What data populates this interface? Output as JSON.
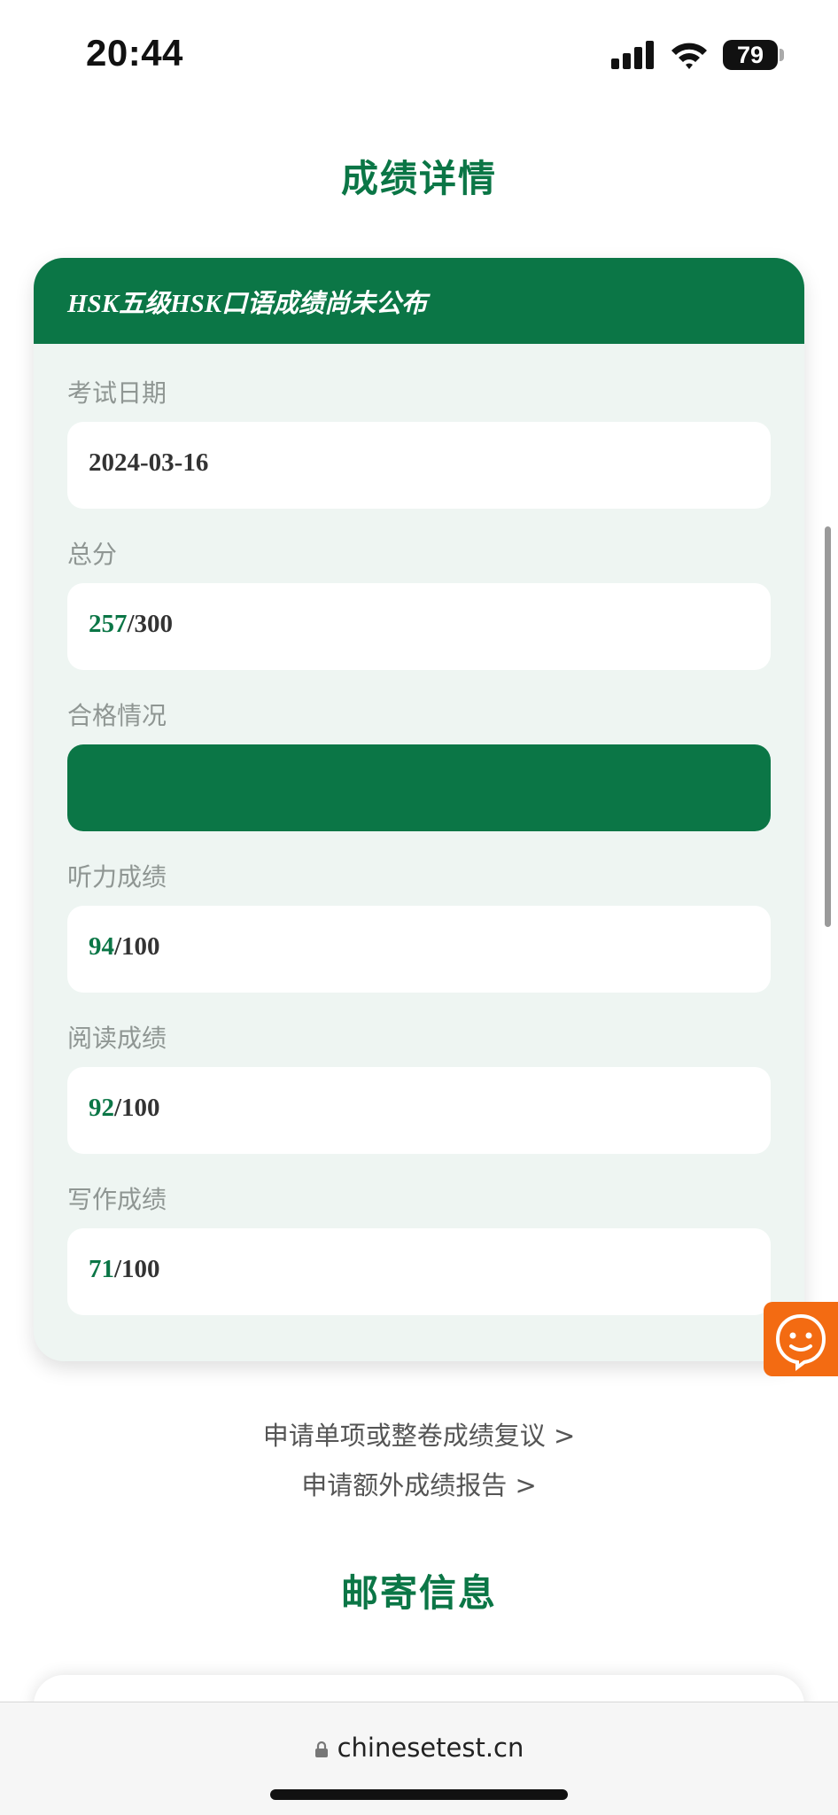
{
  "status_bar": {
    "time": "20:44",
    "battery": "79",
    "icons": [
      "signal-icon",
      "wifi-icon",
      "battery-icon"
    ]
  },
  "score_section": {
    "title": "成绩详情",
    "card_header": "HSK五级HSK口语成绩尚未公布",
    "fields": {
      "exam_date": {
        "label": "考试日期",
        "value": "2024-03-16"
      },
      "total": {
        "label": "总分",
        "score": "257",
        "max": "/300"
      },
      "pass_status": {
        "label": "合格情况",
        "value": ""
      },
      "listening": {
        "label": "听力成绩",
        "score": "94",
        "max": "/100"
      },
      "reading": {
        "label": "阅读成绩",
        "score": "92",
        "max": "/100"
      },
      "writing": {
        "label": "写作成绩",
        "score": "71",
        "max": "/100"
      }
    }
  },
  "links": {
    "review": "申请单项或整卷成绩复议 >",
    "extra_report": "申请额外成绩报告 >"
  },
  "mail_section": {
    "title": "邮寄信息"
  },
  "browser": {
    "url": "chinesetest.cn"
  },
  "colors": {
    "brand_green": "#0b7646",
    "support_orange": "#f36b12",
    "card_bg": "#eef5f2"
  }
}
